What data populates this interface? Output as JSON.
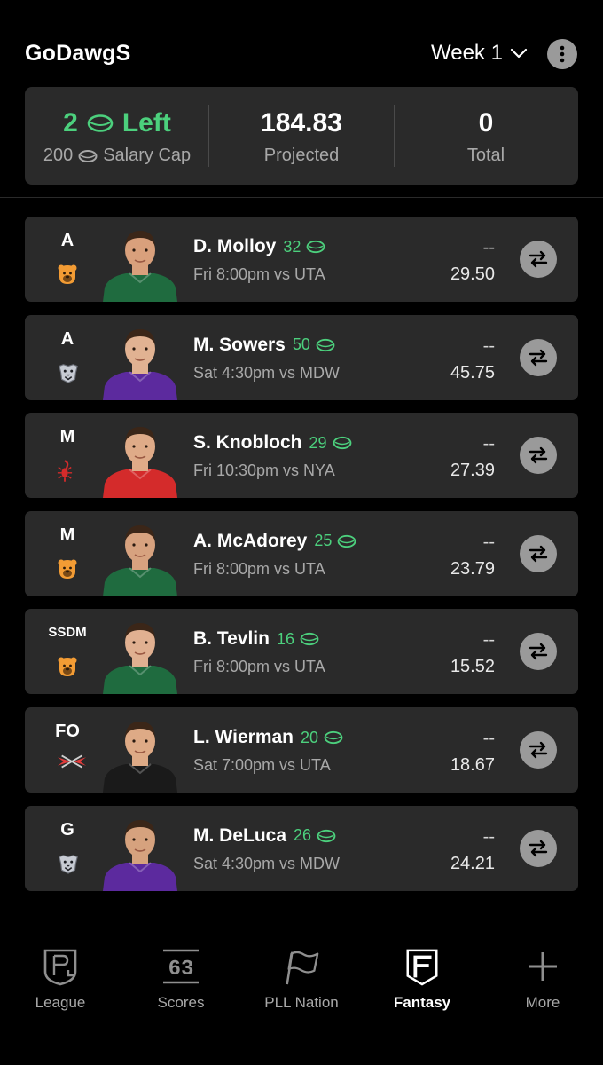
{
  "header": {
    "team_name": "GoDawgS",
    "week_label": "Week 1"
  },
  "summary": {
    "left_value": "2",
    "left_label": "Left",
    "salary_cap_value": "200",
    "salary_cap_label": "Salary Cap",
    "projected_value": "184.83",
    "projected_label": "Projected",
    "total_value": "0",
    "total_label": "Total"
  },
  "roster": [
    {
      "pos": "A",
      "team_icon": "bear-icon",
      "name": "D. Molloy",
      "salary": "32",
      "game": "Fri 8:00pm vs UTA",
      "points": "--",
      "projected": "29.50",
      "jersey": "#1f6b3f",
      "skin": "#d9a07c"
    },
    {
      "pos": "A",
      "team_icon": "dog-icon",
      "name": "M. Sowers",
      "salary": "50",
      "game": "Sat 4:30pm vs MDW",
      "points": "--",
      "projected": "45.75",
      "jersey": "#5c2a9e",
      "skin": "#e1b292"
    },
    {
      "pos": "M",
      "team_icon": "scorpion-icon",
      "name": "S. Knobloch",
      "salary": "29",
      "game": "Fri 10:30pm vs NYA",
      "points": "--",
      "projected": "27.39",
      "jersey": "#d42b2b",
      "skin": "#dfab88"
    },
    {
      "pos": "M",
      "team_icon": "bear-icon",
      "name": "A. McAdorey",
      "salary": "25",
      "game": "Fri 8:00pm vs UTA",
      "points": "--",
      "projected": "23.79",
      "jersey": "#1f6b3f",
      "skin": "#d7a27f"
    },
    {
      "pos": "SSDM",
      "team_icon": "bear-icon",
      "name": "B. Tevlin",
      "salary": "16",
      "game": "Fri 8:00pm vs UTA",
      "points": "--",
      "projected": "15.52",
      "jersey": "#1f6b3f",
      "skin": "#e0b091"
    },
    {
      "pos": "FO",
      "team_icon": "wings-icon",
      "name": "L. Wierman",
      "salary": "20",
      "game": "Sat 7:00pm vs UTA",
      "points": "--",
      "projected": "18.67",
      "jersey": "#1a1a1a",
      "skin": "#deaa86"
    },
    {
      "pos": "G",
      "team_icon": "dog-icon",
      "name": "M. DeLuca",
      "salary": "26",
      "game": "Sat 4:30pm vs MDW",
      "points": "--",
      "projected": "24.21",
      "jersey": "#5c2a9e",
      "skin": "#d6a27e"
    }
  ],
  "nav": [
    {
      "label": "League",
      "icon": "league-shield-icon",
      "active": false
    },
    {
      "label": "Scores",
      "icon": "scoreboard-icon",
      "active": false
    },
    {
      "label": "PLL Nation",
      "icon": "flag-icon",
      "active": false
    },
    {
      "label": "Fantasy",
      "icon": "fantasy-f-icon",
      "active": true
    },
    {
      "label": "More",
      "icon": "plus-icon",
      "active": false
    }
  ],
  "colors": {
    "accent_green": "#4cd07d",
    "card_bg": "#2a2a2a",
    "button_gray": "#9a9a9a"
  }
}
